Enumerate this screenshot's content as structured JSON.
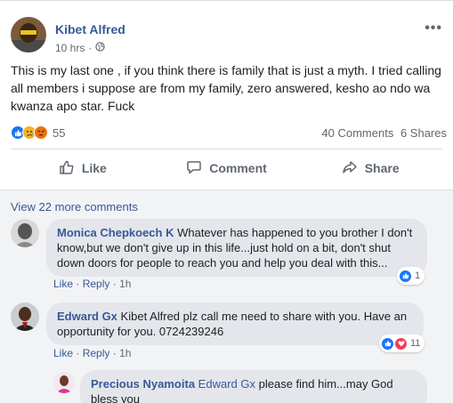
{
  "post": {
    "author": "Kibet Alfred",
    "time": "10 hrs",
    "meta_separator": "·",
    "more": "•••",
    "text": "This is my last one , if you think there is family that is just a myth. I tried calling all members i suppose are from my family, zero answered, kesho ao ndo wa kwanza apo star. Fuck",
    "reaction_count": "55",
    "comments_count": "40 Comments",
    "shares_count": "6 Shares",
    "reaction_icons": [
      "like-reaction-icon",
      "sad-reaction-icon",
      "angry-reaction-icon"
    ]
  },
  "actions": {
    "like": "Like",
    "comment": "Comment",
    "share": "Share"
  },
  "comments": {
    "view_more": "View 22 more comments",
    "items": [
      {
        "name": "Monica Chepkoech K",
        "text": "Whatever has happened to you brother I don't know,but we don't give up in this life...just hold on a bit, don't shut down doors for people to reach you and help you deal with this...",
        "like": "Like",
        "reply": "Reply",
        "sep": "·",
        "time": "1h",
        "reactions": "1"
      },
      {
        "name": "Edward Gx",
        "text": "Kibet Alfred plz call me need to share with you. Have an opportunity for you. 0724239246",
        "like": "Like",
        "reply": "Reply",
        "sep": "·",
        "time": "1h",
        "reactions": "11"
      },
      {
        "name": "Precious Nyamoita",
        "tag": "Edward Gx",
        "text": "please find him...may God bless you"
      }
    ]
  },
  "colors": {
    "link": "#385898",
    "like_blue": "#1877f2",
    "love_red": "#f33e58",
    "sad_yellow": "#f7b125",
    "angry_orange": "#e9710f"
  }
}
